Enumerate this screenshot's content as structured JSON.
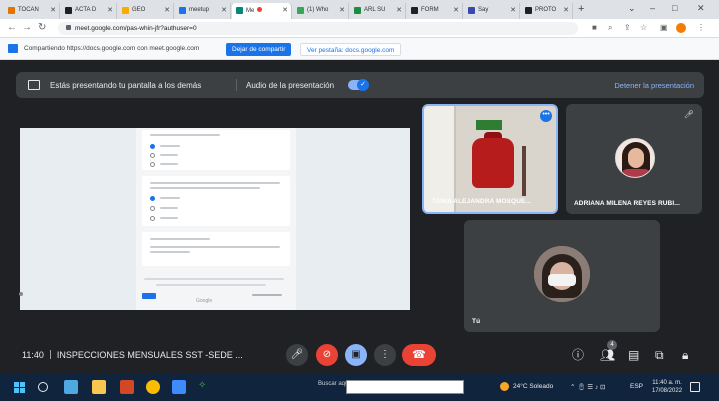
{
  "browser": {
    "tabs": [
      {
        "label": "TOCAN",
        "color": "#e37400"
      },
      {
        "label": "ACTA D",
        "color": "#202124"
      },
      {
        "label": "GEO",
        "color": "#f9ab00"
      },
      {
        "label": "meetup",
        "color": "#1a73e8"
      },
      {
        "label": "Me",
        "color": "#00897b"
      },
      {
        "label": "(1) Who",
        "color": "#34a853"
      },
      {
        "label": "ARL SU",
        "color": "#1e8e3e"
      },
      {
        "label": "FORM",
        "color": "#202124"
      },
      {
        "label": "Say",
        "color": "#3949ab"
      },
      {
        "label": "PROTO",
        "color": "#202124"
      }
    ],
    "new_tab": "+",
    "window_controls": [
      "⌄",
      "–",
      "□",
      "✕"
    ],
    "url": "meet.google.com/pas-whin-jfr?authuser=0"
  },
  "sharing_bar": {
    "text": "Compartiendo https://docs.google.com con meet.google.com",
    "stop_button": "Dejar de compartir",
    "switch_button": "Ver pestaña: docs.google.com"
  },
  "presenting_banner": {
    "text": "Estás presentando tu pantalla a los demás",
    "audio_label": "Audio de la presentación",
    "audio_on": true,
    "stop_label": "Detener la presentación"
  },
  "participants": [
    {
      "name": "TANIA ALEJANDRA MOSQUE...",
      "active_speaker": true
    },
    {
      "name": "ADRIANA MILENA REYES RUBI...",
      "muted": true
    },
    {
      "name": "Tú"
    }
  ],
  "meeting": {
    "time": "11:40",
    "title": "INSPECCIONES MENSUALES SST -SEDE ..."
  },
  "controls": {
    "mic_icon": "mic-icon",
    "camera_icon": "camera-off-icon",
    "present_icon": "present-icon",
    "more_icon": "more-icon",
    "end_call_icon": "end-call-icon",
    "people_count": "4"
  },
  "taskbar": {
    "search_label": "Buscar aquí",
    "weather": "24°C Soleado",
    "lang": "ESP",
    "time": "11:40 a. m.",
    "date": "17/08/2022"
  },
  "colors": {
    "meet_bg": "#202124",
    "accent_blue": "#1a73e8",
    "end_call_red": "#ea4335"
  }
}
